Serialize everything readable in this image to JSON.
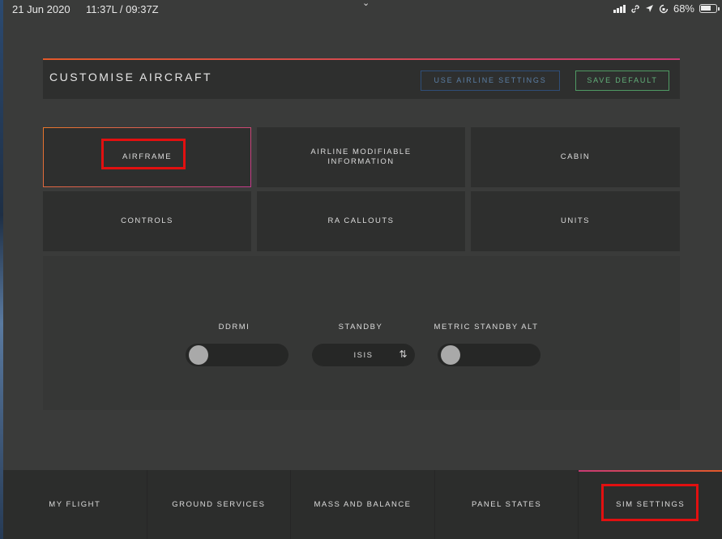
{
  "status_bar": {
    "date": "21 Jun 2020",
    "time": "11:37L / 09:37Z",
    "battery": "68%",
    "battery_level": 0.68
  },
  "header": {
    "title": "CUSTOMISE AIRCRAFT",
    "use_airline_settings": "USE AIRLINE SETTINGS",
    "save_default": "SAVE DEFAULT"
  },
  "categories": [
    {
      "label": "AIRFRAME"
    },
    {
      "label": "AIRLINE MODIFIABLE\nINFORMATION"
    },
    {
      "label": "CABIN"
    },
    {
      "label": "CONTROLS"
    },
    {
      "label": "RA CALLOUTS"
    },
    {
      "label": "UNITS"
    }
  ],
  "settings": {
    "ddrmi_label": "DDRMI",
    "standby_label": "STANDBY",
    "standby_value": "ISIS",
    "metric_label": "METRIC STANDBY ALT"
  },
  "nav": [
    {
      "label": "MY FLIGHT"
    },
    {
      "label": "GROUND SERVICES"
    },
    {
      "label": "MASS AND BALANCE"
    },
    {
      "label": "PANEL STATES"
    },
    {
      "label": "SIM SETTINGS"
    }
  ],
  "colors": {
    "accent_orange": "#e2592a",
    "accent_pink": "#c83a74",
    "airline_btn_blue": "#5b7fa6",
    "save_btn_green": "#62b07a",
    "highlight_red": "#e11010"
  }
}
